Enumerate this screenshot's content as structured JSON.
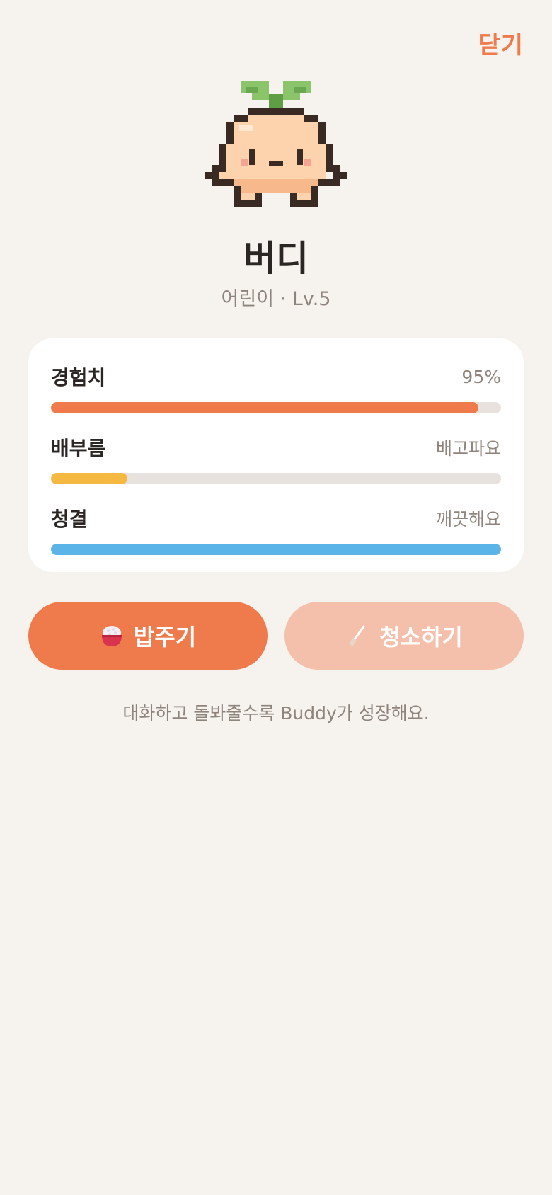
{
  "header": {
    "close_label": "닫기",
    "accent_color": "#ef7a4b"
  },
  "pet": {
    "name": "버디",
    "subtitle": "어린이 · Lv.5",
    "avatar_icon": "sprout-pet-icon"
  },
  "stats": [
    {
      "label": "경험치",
      "value_text": "95%",
      "fill_fraction": 0.95,
      "color": "#ef7a4b"
    },
    {
      "label": "배부름",
      "value_text": "배고파요",
      "fill_fraction": 0.17,
      "color": "#f5b942"
    },
    {
      "label": "청결",
      "value_text": "깨끗해요",
      "fill_fraction": 1.0,
      "color": "#5ab4e8"
    }
  ],
  "actions": {
    "feed_label": "밥주기",
    "feed_icon": "rice-bowl-icon",
    "feed_color": "#ef7a4b",
    "clean_label": "청소하기",
    "clean_icon": "broom-icon",
    "clean_color": "#f4c0ab"
  },
  "footer": {
    "note": "대화하고 돌봐줄수록 Buddy가 성장해요."
  }
}
